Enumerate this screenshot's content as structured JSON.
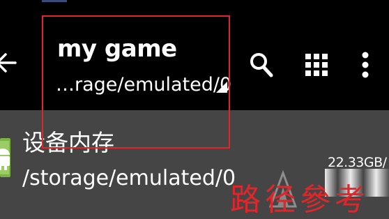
{
  "toolbar": {
    "title": "my game",
    "path": "…rage/emulated/0",
    "back_icon": "back-arrow-icon",
    "search_icon": "search-icon",
    "grid_icon": "grid-view-icon",
    "more_icon": "more-vert-icon"
  },
  "storage": {
    "name": "设备内存",
    "path": "/storage/emulated/0",
    "size": "22.33GB/",
    "icon": "android-icon"
  },
  "annotation": {
    "text": "路径參考",
    "color": "#e0262b"
  },
  "colors": {
    "toolbar_bg": "#000000",
    "content_bg": "#454545",
    "highlight": "#e0262b",
    "android_green": "#8bc34a"
  }
}
